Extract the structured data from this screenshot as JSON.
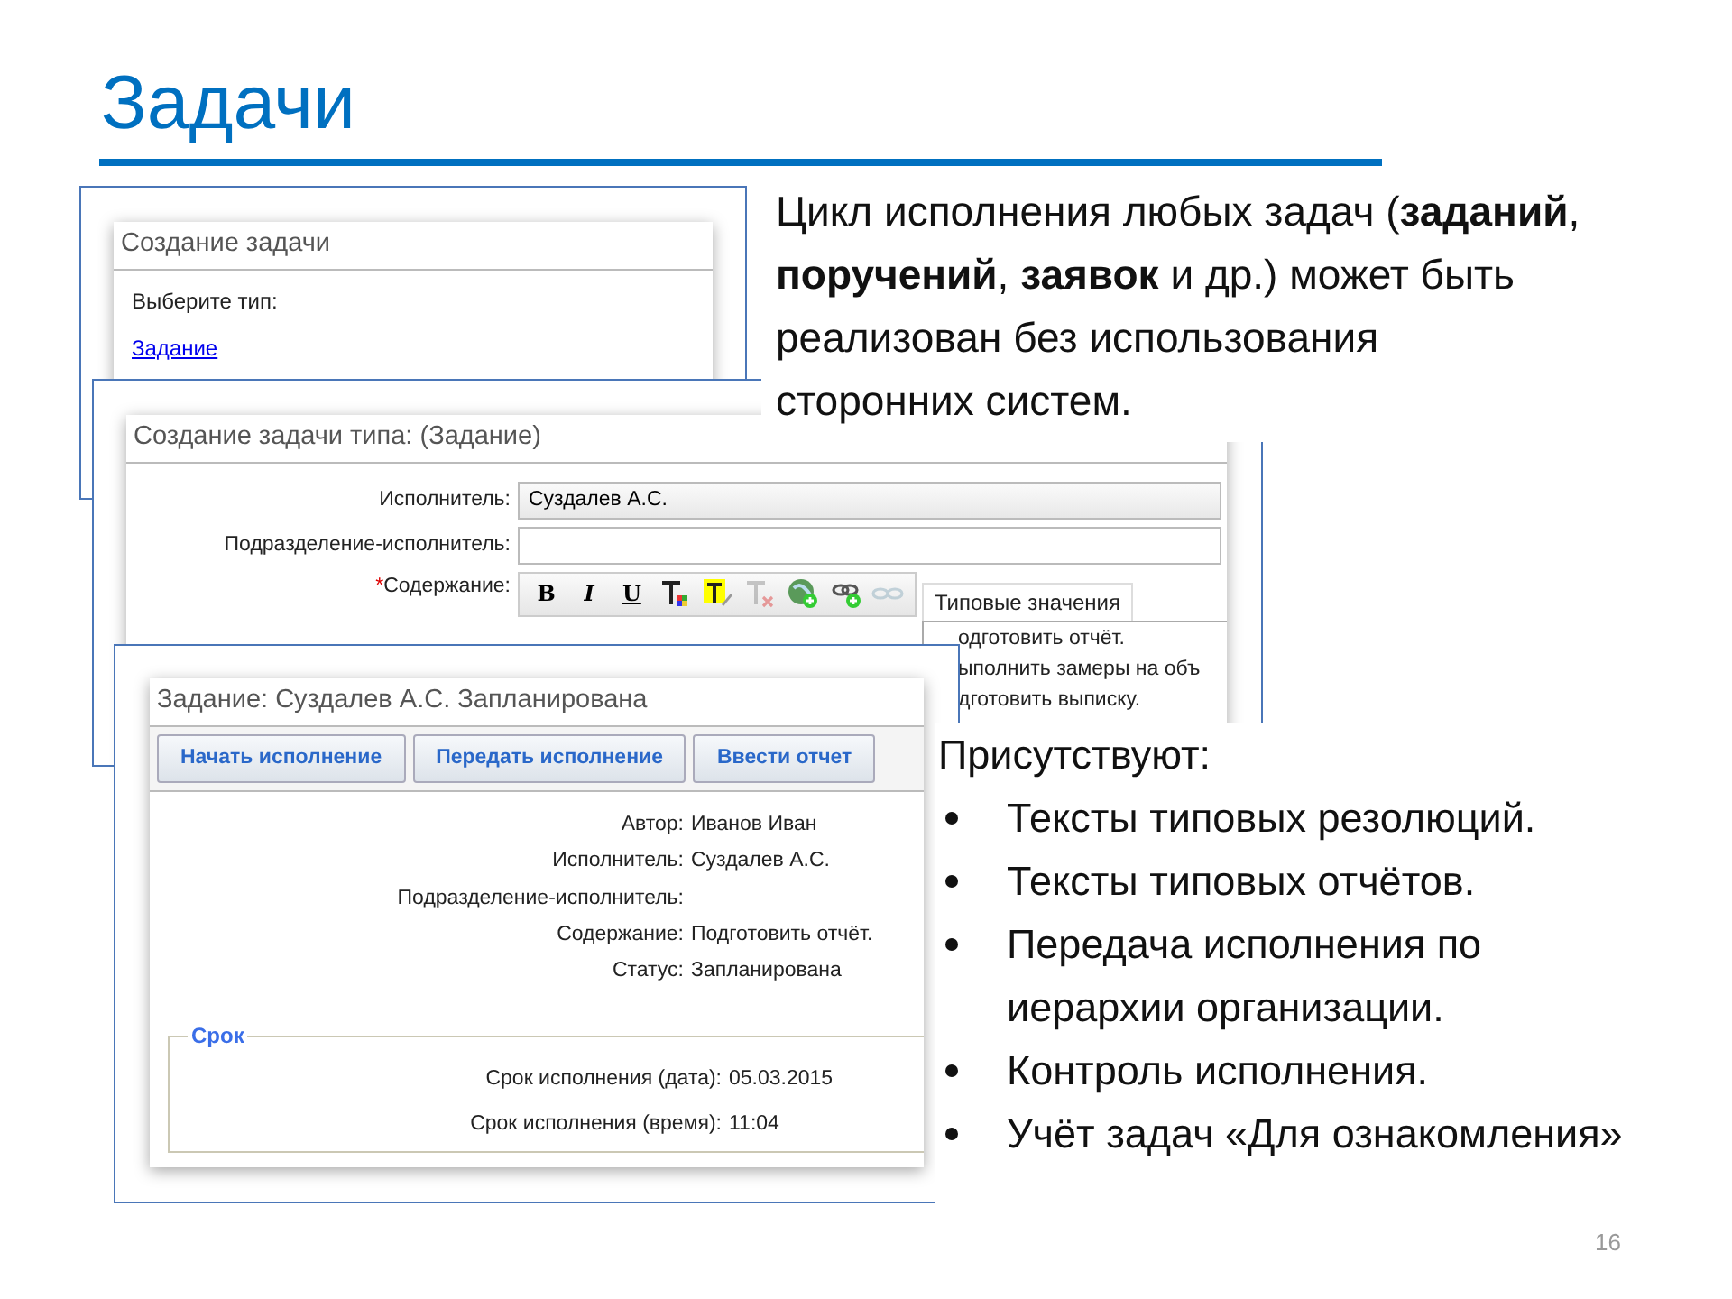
{
  "slide": {
    "title": "Задачи",
    "page_number": "16"
  },
  "intro_text": "Цикл исполнения любых задач (**заданий**, **поручений**, **заявок** и др.) может быть реализован без использования сторонних систем.",
  "windows": [
    {
      "kind": "type_picker",
      "title": "Создание задачи",
      "prompt": "Выберите тип:",
      "links": [
        "Задание"
      ]
    },
    {
      "kind": "create_form",
      "title": "Создание задачи типа: (Задание)",
      "fields": [
        {
          "kind": "input",
          "label": "Исполнитель:",
          "value": "Суздалев А.С.",
          "readonly": true
        },
        {
          "kind": "input",
          "label": "Подразделение-исполнитель:",
          "readonly": false
        },
        {
          "kind": "editor",
          "label": "Содержание:",
          "required_mark": "*"
        }
      ],
      "toolbar": [
        {
          "kind": "bold",
          "label": "B",
          "disabled": false
        },
        {
          "kind": "italic",
          "label": "I",
          "disabled": false
        },
        {
          "kind": "underline",
          "label": "U",
          "disabled": false
        },
        {
          "kind": "text_color",
          "disabled": false
        },
        {
          "kind": "highlight",
          "disabled": false
        },
        {
          "kind": "clear_format",
          "disabled": true
        },
        {
          "kind": "globe",
          "disabled": false
        },
        {
          "kind": "link",
          "disabled": false
        },
        {
          "kind": "unlink",
          "disabled": true
        }
      ],
      "typical_values": {
        "title": "Типовые значения",
        "items": [
          {
            "text": "одготовить отчёт."
          },
          {
            "text": "ыполнить замеры на объ"
          },
          {
            "text": "дготовить выписку."
          }
        ]
      }
    },
    {
      "kind": "task_view",
      "title": "Задание: Суздалев А.С. Запланирована",
      "buttons": [
        "Начать исполнение",
        "Передать исполнение",
        "Ввести отчет"
      ],
      "details": [
        {
          "label": "Автор:",
          "value": "Иванов Иван"
        },
        {
          "label": "Исполнитель:",
          "value": "Суздалев А.С."
        },
        {
          "label": "Подразделение-исполнитель:"
        },
        {
          "label": "Содержание:",
          "value": "Подготовить отчёт."
        },
        {
          "label": "Статус:",
          "value": "Запланирована"
        }
      ],
      "deadline": {
        "legend": "Срок",
        "rows": [
          {
            "label": "Срок исполнения (дата):",
            "value": "05.03.2015"
          },
          {
            "label": "Срок исполнения (время):",
            "value": "11:04"
          }
        ]
      }
    }
  ],
  "presence": {
    "heading": "Присутствуют:",
    "items": [
      "Тексты типовых резолюций.",
      "Тексты типовых отчётов.",
      "Передача исполнения по иерархии организации.",
      "Контроль исполнения.",
      "Учёт задач «Для ознакомления»"
    ]
  }
}
